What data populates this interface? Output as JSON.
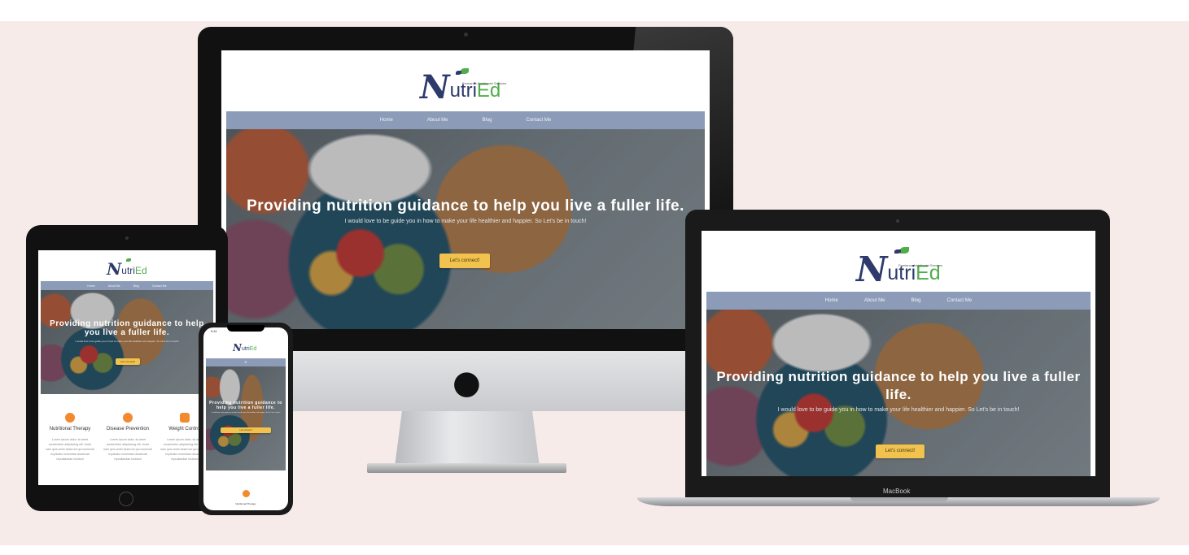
{
  "brand": {
    "logo_mark": "N",
    "logo_rest": "utri",
    "logo_ed": "Ed",
    "tagline": "Freelance Nutritionist Services"
  },
  "nav": {
    "items": [
      "Home",
      "About Me",
      "Blog",
      "Contact Me"
    ]
  },
  "hero": {
    "heading": "Providing nutrition guidance to help you live a fuller life.",
    "subtext": "I would love to be guide you in how to make your life healthier and happier. So Let's be in touch!",
    "cta_label": "Let's connect!"
  },
  "features": [
    {
      "title": "Nutritional Therapy",
      "icon": "apple-icon"
    },
    {
      "title": "Disease Prevention",
      "icon": "virus-icon"
    },
    {
      "title": "Weight Control",
      "icon": "scale-icon"
    }
  ],
  "feature_body": "Lorem ipsum dolor, sit amet consectetur adipisicing elit. Unde nam quis amet deserunt qui commodi explicabo molestias obcaecati repudiandae incidunt",
  "phone": {
    "status_time": "9:41",
    "feature_title": "Nutritional Therapy"
  },
  "device_labels": {
    "macbook": "MacBook"
  },
  "colors": {
    "navbar": "#8b9bb8",
    "cta": "#f1c24d",
    "brand_navy": "#2d3a6b",
    "brand_green": "#4fae4a",
    "accent_orange": "#f28a2e",
    "background": "#f7ebea"
  }
}
